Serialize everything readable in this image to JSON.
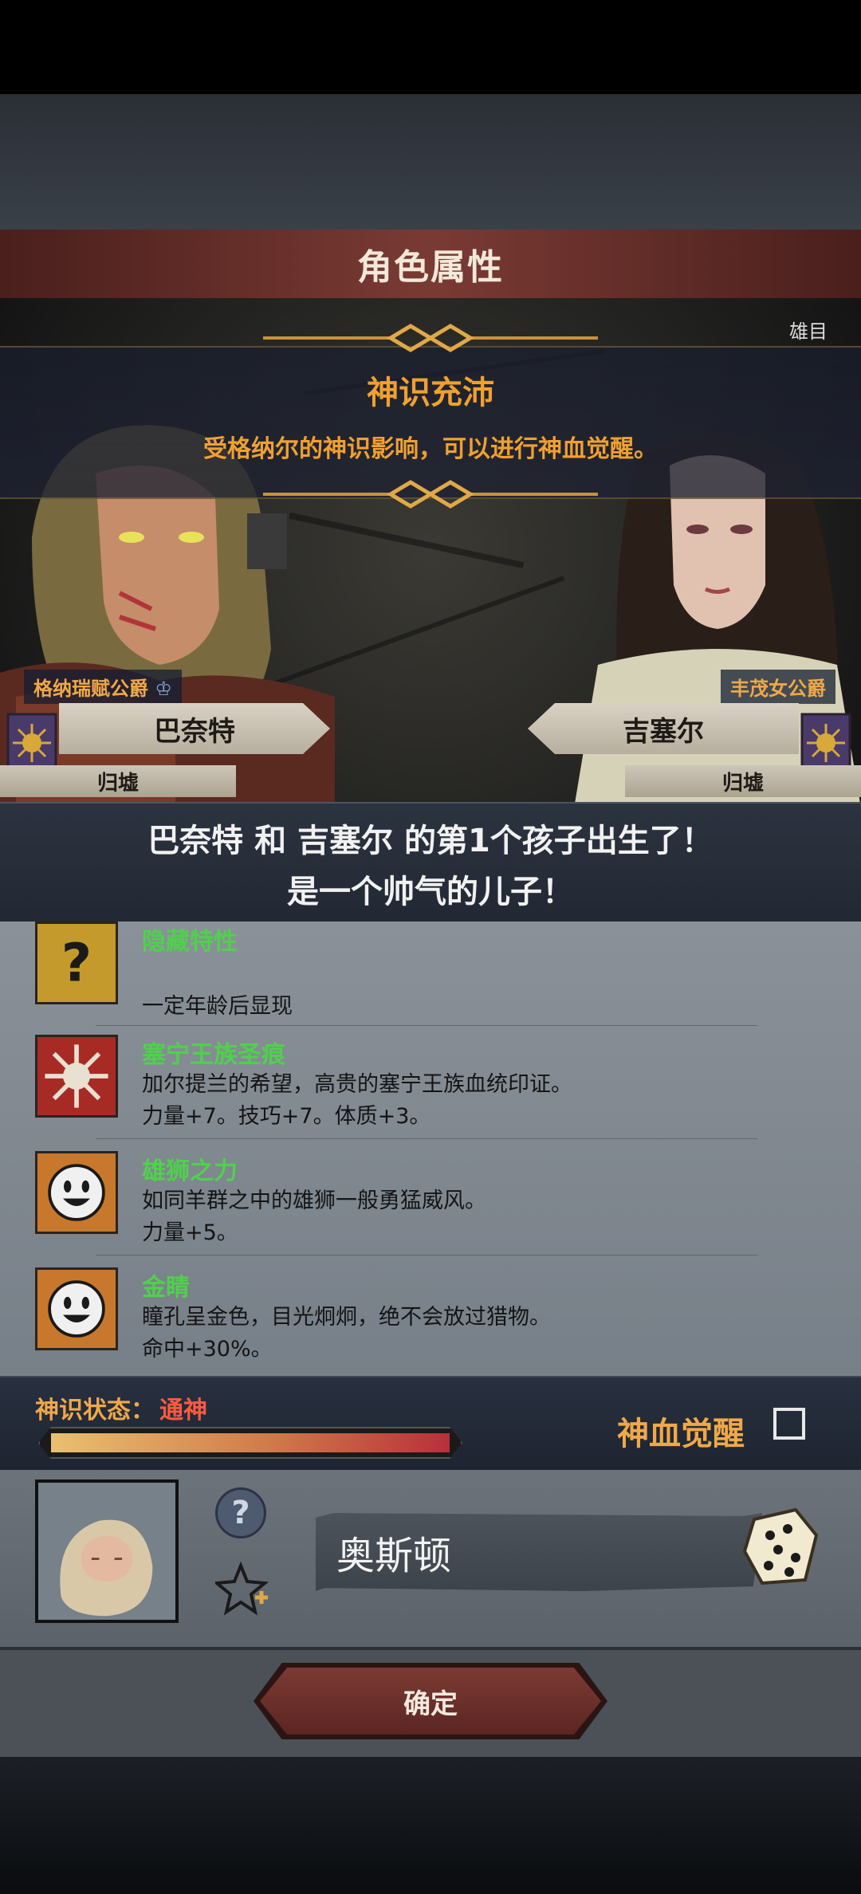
{
  "header": {
    "title": "角色属性"
  },
  "awakening": {
    "title": "神识充沛",
    "description": "受格纳尔的神识影响，可以进行神血觉醒。"
  },
  "father": {
    "title": "格纳瑞赋公爵",
    "name": "巴奈特",
    "status": "归墟"
  },
  "mother": {
    "title": "丰茂女公爵",
    "name": "吉塞尔",
    "status": "归墟"
  },
  "scene": {
    "corner_text": "雄目"
  },
  "birth_message": {
    "line1": "巴奈特 和 吉塞尔 的第1个孩子出生了！",
    "line2": "是一个帅气的儿子！"
  },
  "traits": [
    {
      "name": "隐藏特性",
      "description": "",
      "effect": "一定年龄后显现",
      "icon": "question-icon"
    },
    {
      "name": "塞宁王族圣痕",
      "description": "加尔提兰的希望，高贵的塞宁王族血统印证。",
      "effect": "力量+7。技巧+7。体质+3。",
      "icon": "sun-emblem-icon"
    },
    {
      "name": "雄狮之力",
      "description": "如同羊群之中的雄狮一般勇猛威风。",
      "effect": "力量+5。",
      "icon": "smiley-icon"
    },
    {
      "name": "金睛",
      "description": "瞳孔呈金色，目光炯炯，绝不会放过猎物。",
      "effect": "命中+30%。",
      "icon": "smiley-icon"
    }
  ],
  "status": {
    "label": "神识状态：",
    "value": "通神",
    "progress": 1.0,
    "blood_awaken_label": "神血觉醒",
    "blood_awaken_checked": false
  },
  "child": {
    "name": "奥斯顿",
    "help_symbol": "?"
  },
  "footer": {
    "confirm_label": "确定"
  },
  "colors": {
    "accent_orange": "#f0a848",
    "trait_green": "#4fd14c",
    "status_red": "#ff5a40"
  }
}
